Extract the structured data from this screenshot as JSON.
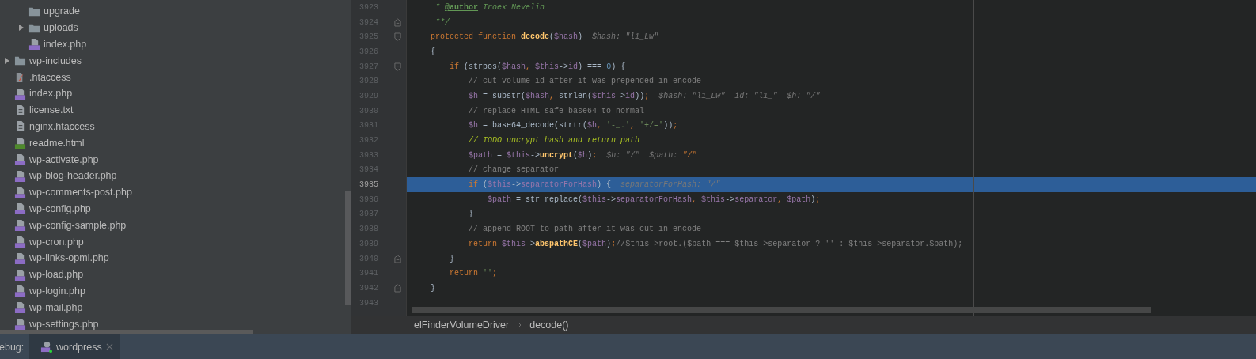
{
  "project_tree": [
    {
      "children": [
        {
          "name": "upgrade",
          "kind": "folder"
        },
        {
          "name": "uploads",
          "kind": "folder",
          "expanded": false
        },
        {
          "name": "index.php",
          "kind": "php"
        }
      ]
    },
    {
      "name": "wp-includes",
      "kind": "folder",
      "expanded": false
    },
    {
      "name": ".htaccess",
      "kind": "htaccess"
    },
    {
      "name": "index.php",
      "kind": "php"
    },
    {
      "name": "license.txt",
      "kind": "text"
    },
    {
      "name": "nginx.htaccess",
      "kind": "text"
    },
    {
      "name": "readme.html",
      "kind": "html"
    },
    {
      "name": "wp-activate.php",
      "kind": "php"
    },
    {
      "name": "wp-blog-header.php",
      "kind": "php"
    },
    {
      "name": "wp-comments-post.php",
      "kind": "php"
    },
    {
      "name": "wp-config.php",
      "kind": "php"
    },
    {
      "name": "wp-config-sample.php",
      "kind": "php"
    },
    {
      "name": "wp-cron.php",
      "kind": "php"
    },
    {
      "name": "wp-links-opml.php",
      "kind": "php"
    },
    {
      "name": "wp-load.php",
      "kind": "php"
    },
    {
      "name": "wp-login.php",
      "kind": "php"
    },
    {
      "name": "wp-mail.php",
      "kind": "php"
    },
    {
      "name": "wp-settings.php",
      "kind": "php"
    }
  ],
  "editor": {
    "lines": [
      {
        "number": "3923",
        "selected": false,
        "kind": "code",
        "tokens": [
          {
            "t": "     * ",
            "kind": "doc"
          },
          {
            "t": "@author",
            "kind": "doctag"
          },
          {
            "t": " Troex Nevelin",
            "kind": "doc"
          }
        ]
      },
      {
        "number": "3924",
        "selected": false,
        "kind": "fold-end",
        "tokens": [
          {
            "t": "     **/",
            "kind": "doc"
          }
        ]
      },
      {
        "number": "3925",
        "selected": false,
        "kind": "fold-start",
        "tokens": [
          {
            "t": "    protected function ",
            "kind": "kw"
          },
          {
            "t": "decode",
            "kind": "fn"
          },
          {
            "t": "(",
            "kind": "plain"
          },
          {
            "t": "$hash",
            "kind": "var"
          },
          {
            "t": ")",
            "kind": "plain"
          },
          {
            "t": "  $hash: \"l1_Lw\"",
            "kind": "hint"
          }
        ]
      },
      {
        "number": "3926",
        "selected": false,
        "kind": "code",
        "tokens": [
          {
            "t": "    {",
            "kind": "plain"
          }
        ]
      },
      {
        "number": "3927",
        "selected": false,
        "kind": "fold-start",
        "tokens": [
          {
            "t": "        if ",
            "kind": "kw"
          },
          {
            "t": "(strpos(",
            "kind": "plain"
          },
          {
            "t": "$hash",
            "kind": "var"
          },
          {
            "t": ", ",
            "kind": "kw"
          },
          {
            "t": "$this",
            "kind": "var"
          },
          {
            "t": "->",
            "kind": "plain"
          },
          {
            "t": "id",
            "kind": "var"
          },
          {
            "t": ") === ",
            "kind": "plain"
          },
          {
            "t": "0",
            "kind": "num"
          },
          {
            "t": ") {",
            "kind": "plain"
          }
        ]
      },
      {
        "number": "3928",
        "selected": false,
        "kind": "code",
        "tokens": [
          {
            "t": "            // cut volume id after it was prepended in encode",
            "kind": "comment"
          }
        ]
      },
      {
        "number": "3929",
        "selected": false,
        "kind": "code",
        "tokens": [
          {
            "t": "            $h",
            "kind": "var"
          },
          {
            "t": " = substr(",
            "kind": "plain"
          },
          {
            "t": "$hash",
            "kind": "var"
          },
          {
            "t": ", ",
            "kind": "kw"
          },
          {
            "t": "strlen(",
            "kind": "plain"
          },
          {
            "t": "$this",
            "kind": "var"
          },
          {
            "t": "->",
            "kind": "plain"
          },
          {
            "t": "id",
            "kind": "var"
          },
          {
            "t": "))",
            "kind": "plain"
          },
          {
            "t": ";",
            "kind": "kw"
          },
          {
            "t": "  $hash: \"l1_Lw\"  id: \"l1_\"  $h: \"/\"",
            "kind": "hint"
          }
        ]
      },
      {
        "number": "3930",
        "selected": false,
        "kind": "code",
        "tokens": [
          {
            "t": "            // replace HTML safe base64 to normal",
            "kind": "comment"
          }
        ]
      },
      {
        "number": "3931",
        "selected": false,
        "kind": "code",
        "tokens": [
          {
            "t": "            $h",
            "kind": "var"
          },
          {
            "t": " = base64_decode(strtr(",
            "kind": "plain"
          },
          {
            "t": "$h",
            "kind": "var"
          },
          {
            "t": ", ",
            "kind": "kw"
          },
          {
            "t": "'-_.'",
            "kind": "str"
          },
          {
            "t": ", ",
            "kind": "kw"
          },
          {
            "t": "'+/='",
            "kind": "str"
          },
          {
            "t": "))",
            "kind": "plain"
          },
          {
            "t": ";",
            "kind": "kw"
          }
        ]
      },
      {
        "number": "3932",
        "selected": false,
        "kind": "code",
        "tokens": [
          {
            "t": "            // TODO uncrypt hash and return path",
            "kind": "todo"
          }
        ]
      },
      {
        "number": "3933",
        "selected": false,
        "kind": "code",
        "tokens": [
          {
            "t": "            $path",
            "kind": "var"
          },
          {
            "t": " = ",
            "kind": "plain"
          },
          {
            "t": "$this",
            "kind": "var"
          },
          {
            "t": "->",
            "kind": "plain"
          },
          {
            "t": "uncrypt",
            "kind": "fn"
          },
          {
            "t": "(",
            "kind": "plain"
          },
          {
            "t": "$h",
            "kind": "var"
          },
          {
            "t": ")",
            "kind": "plain"
          },
          {
            "t": ";",
            "kind": "kw"
          },
          {
            "t": "  $h: \"/\"  $path: ",
            "kind": "hint"
          },
          {
            "t": "\"/\"",
            "kind": "hint-changed"
          }
        ]
      },
      {
        "number": "3934",
        "selected": false,
        "kind": "code",
        "tokens": [
          {
            "t": "            // change separator",
            "kind": "comment"
          }
        ]
      },
      {
        "number": "3935",
        "selected": true,
        "kind": "code",
        "tokens": [
          {
            "t": "            if ",
            "kind": "kw"
          },
          {
            "t": "(",
            "kind": "plain"
          },
          {
            "t": "$this",
            "kind": "var"
          },
          {
            "t": "->",
            "kind": "plain"
          },
          {
            "t": "separatorForHash",
            "kind": "var"
          },
          {
            "t": ") {",
            "kind": "plain"
          },
          {
            "t": "  separatorForHash: \"/\"",
            "kind": "hint"
          }
        ]
      },
      {
        "number": "3936",
        "selected": false,
        "kind": "code",
        "tokens": [
          {
            "t": "                $path",
            "kind": "var"
          },
          {
            "t": " = str_replace(",
            "kind": "plain"
          },
          {
            "t": "$this",
            "kind": "var"
          },
          {
            "t": "->",
            "kind": "plain"
          },
          {
            "t": "separatorForHash",
            "kind": "var"
          },
          {
            "t": ", ",
            "kind": "kw"
          },
          {
            "t": "$this",
            "kind": "var"
          },
          {
            "t": "->",
            "kind": "plain"
          },
          {
            "t": "separator",
            "kind": "var"
          },
          {
            "t": ", ",
            "kind": "kw"
          },
          {
            "t": "$path",
            "kind": "var"
          },
          {
            "t": ")",
            "kind": "plain"
          },
          {
            "t": ";",
            "kind": "kw"
          }
        ]
      },
      {
        "number": "3937",
        "selected": false,
        "kind": "code",
        "tokens": [
          {
            "t": "            }",
            "kind": "plain"
          }
        ]
      },
      {
        "number": "3938",
        "selected": false,
        "kind": "code",
        "tokens": [
          {
            "t": "            // append ROOT to path after it was cut in encode",
            "kind": "comment"
          }
        ]
      },
      {
        "number": "3939",
        "selected": false,
        "kind": "code",
        "tokens": [
          {
            "t": "            return ",
            "kind": "kw"
          },
          {
            "t": "$this",
            "kind": "var"
          },
          {
            "t": "->",
            "kind": "plain"
          },
          {
            "t": "abspathCE",
            "kind": "fn"
          },
          {
            "t": "(",
            "kind": "plain"
          },
          {
            "t": "$path",
            "kind": "var"
          },
          {
            "t": ")",
            "kind": "plain"
          },
          {
            "t": ";",
            "kind": "kw"
          },
          {
            "t": "//$this->root.($path === $this->separator ? '' : $this->separator.$path);",
            "kind": "comment"
          }
        ]
      },
      {
        "number": "3940",
        "selected": false,
        "kind": "fold-end",
        "tokens": [
          {
            "t": "        }",
            "kind": "plain"
          }
        ]
      },
      {
        "number": "3941",
        "selected": false,
        "kind": "code",
        "tokens": [
          {
            "t": "        return ",
            "kind": "kw"
          },
          {
            "t": "''",
            "kind": "str"
          },
          {
            "t": ";",
            "kind": "kw"
          }
        ]
      },
      {
        "number": "3942",
        "selected": false,
        "kind": "fold-end",
        "tokens": [
          {
            "t": "    }",
            "kind": "plain"
          }
        ]
      },
      {
        "number": "3943",
        "selected": false,
        "kind": "code"
      }
    ],
    "breadcrumbs": [
      "elFinderVolumeDriver",
      "decode()"
    ]
  },
  "debug_bar": {
    "label": "ebug:",
    "tabs": [
      {
        "label": "wordpress",
        "selected": true
      }
    ]
  }
}
